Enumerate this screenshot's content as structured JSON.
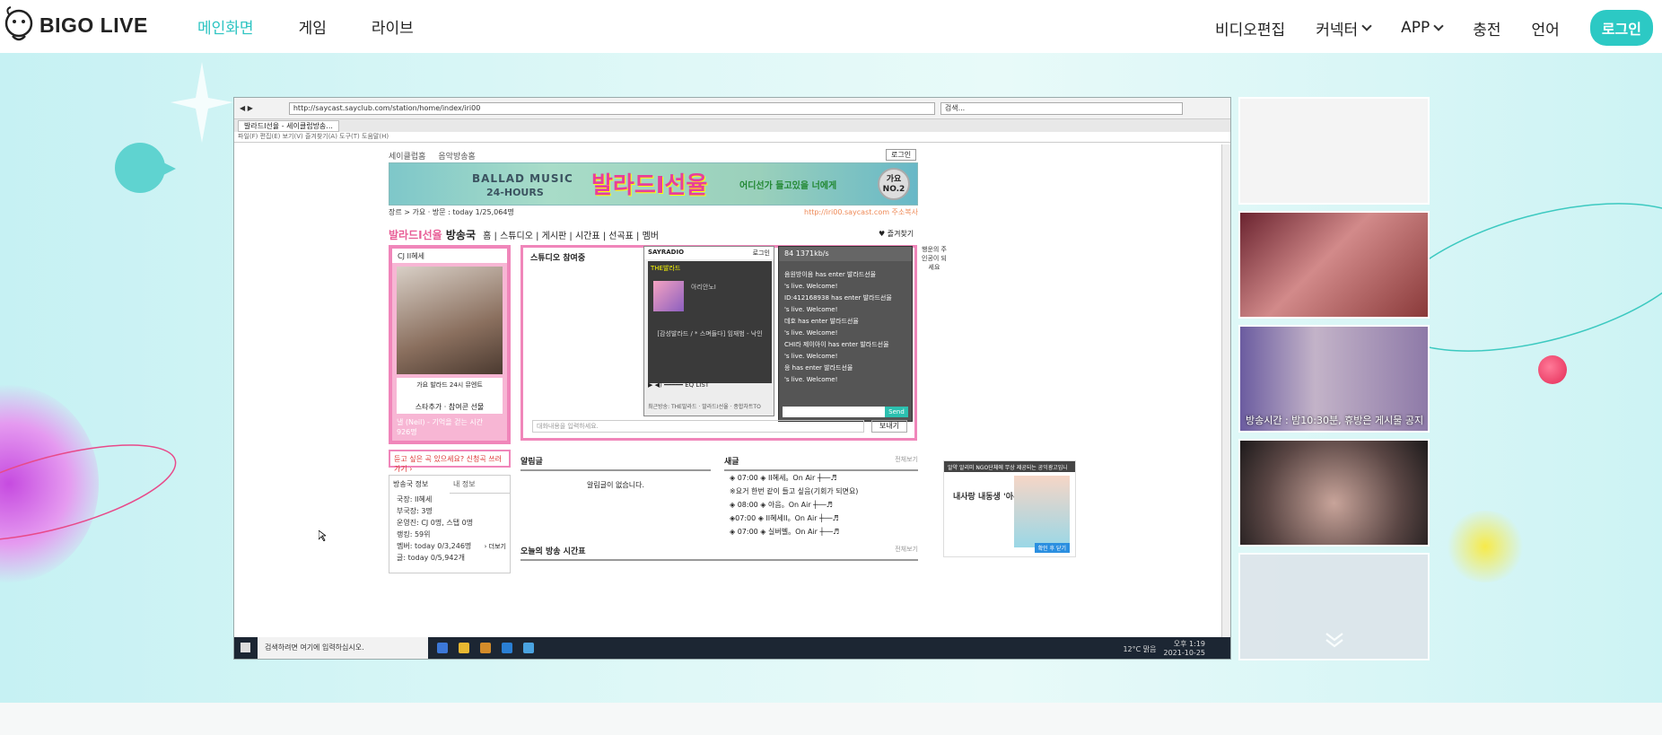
{
  "header": {
    "logo_text": "BIGO LIVE",
    "nav_left": [
      "메인화면",
      "게임",
      "라이브"
    ],
    "nav_right": [
      {
        "label": "비디오편집",
        "dropdown": false
      },
      {
        "label": "커넥터",
        "dropdown": true
      },
      {
        "label": "APP",
        "dropdown": true
      },
      {
        "label": "충전",
        "dropdown": false
      },
      {
        "label": "언어",
        "dropdown": false
      }
    ],
    "login": "로그인",
    "accent": "#2cc4c2"
  },
  "stream": {
    "browser": {
      "address": "http://saycast.sayclub.com/station/home/index/iri00",
      "search_placeholder": "검색...",
      "tab": "발라드I선율 - 세이클럽방송...",
      "menu": "파일(F)   편집(E)   보기(V)   즐겨찾기(A)   도구(T)   도움말(H)"
    },
    "page": {
      "subnav": [
        "세이클럽홈",
        "음악방송홈"
      ],
      "login": "로그인",
      "banner_line1": "BALLAD MUSIC",
      "banner_line2": "24-HOURS",
      "banner_title": "발라드I선율",
      "banner_tagline": "어디선가 들고있을 너에게",
      "banner_badge": "가요 NO.2",
      "crumb": "장르 > 가요 · 방문 : today 1/25,064명",
      "crumb_right": "http://iri00.saycast.com  주소복사",
      "station_name": "발라드I선율",
      "station_suffix": "방송국",
      "station_menu": "홈 | 스튜디오 | 게시판 | 시간표 | 선곡표 | 멤버",
      "favorite": "♥ 즐겨찾기",
      "dj_label": "CJ  II혜세",
      "dj_sub": "가요 발라드 24시 뮤엔트",
      "dj_links": "스타추가 · 참여콘 선물",
      "dj_song": "낼 (Neil) - 기억을 걷는 시간",
      "dj_count": "926명",
      "studio_title": "스튜디오 참여중",
      "player_brand": "SAYRADIO",
      "player_login": "로그인",
      "player_name": "THE발라드",
      "player_dj": "아리안노I",
      "player_lyric": "[감성발라드 / * 스며들다] 임재범 - 낙인",
      "player_footer": "최근방송: THE발라드 · 발라드I선율 · 종합차트TO",
      "chat_stats": "84   1371kb/s",
      "chat_lines": [
        "음원방이음 has enter  발라드선율",
        "'s live. Welcome!",
        "ID:412168938 has enter  발라드선율",
        "'s live. Welcome!",
        "데호 has enter  발라드선율",
        "'s live. Welcome!",
        "CHI라 제이아이 has enter  발라드선율",
        "'s live. Welcome!",
        "응 has enter  발라드선율",
        "'s live. Welcome!"
      ],
      "chat_send": "Send",
      "studio_input": "대화내용을 입력하세요.",
      "studio_send": "보내기",
      "request": "듣고 싶은 곡 있으세요? 신청곡 쓰러가기 ›",
      "info_tabs": [
        "방송국 정보",
        "내 정보"
      ],
      "info_rows": [
        "국장: II혜세",
        "부국장: 3명",
        "운영진: CJ 0명, 스탭 0명",
        "랭킹: 59위",
        "멤버: today 0/3,246명",
        "글: today 0/5,942개"
      ],
      "info_more": "› 더보기",
      "notice_title": "알림글",
      "notice_empty": "알림글이 없습니다.",
      "wall_title": "새글",
      "wall_more": "전체보기",
      "wall_items": [
        "◈ 07:00 ◈ II혜세。On Air ┼──♬",
        "※요거 한번 같이 들고 싶음(기회가 되면요)",
        "◈ 08:00 ◈ 아음。On Air ┼──♬",
        "◈07:00 ◈ II혜세II。On Air ┼──♬",
        "◈ 07:00 ◈ 실버벨。On Air ┼──♬"
      ],
      "today_title": "오늘의 방송 시간표",
      "today_more": "전체보기",
      "side_text": "행운의 주인공이 되세요",
      "ad_head": "알약 알리미   NGO단체에 무상 제공되는 공익광고입니다.",
      "ad_text": "내사랑 내동생 '아부바'",
      "ad_btn": "확인 후 닫기"
    },
    "taskbar": {
      "search": "검색하려면 여기에 입력하십시오.",
      "weather": "12°C 맑음",
      "time": "오후 1:19",
      "date": "2021-10-25"
    }
  },
  "thumbnails": [
    {
      "caption": ""
    },
    {
      "caption": ""
    },
    {
      "caption": "방송시간 : 밤10:30분, 휴방은 게시물 공지"
    },
    {
      "caption": ""
    },
    {
      "caption": ""
    }
  ]
}
